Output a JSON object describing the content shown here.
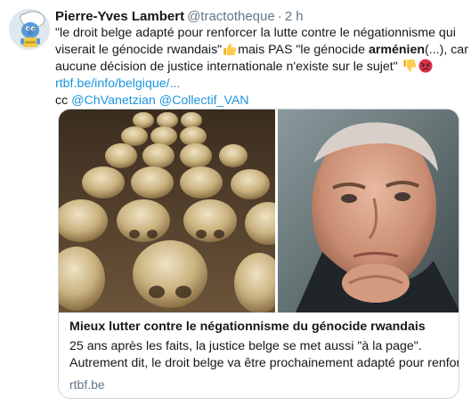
{
  "tweet": {
    "author_name": "Pierre-Yves Lambert",
    "author_handle": "@tractotheque",
    "separator": "·",
    "time": "2 h",
    "lines": {
      "l1": "\"le droit belge adapté pour renforcer la lutte contre le négationnisme qui",
      "l2a": "viserait le génocide rwandais\"",
      "l2b": "mais PAS \"le génocide ",
      "l2c": "arménien",
      "l2d": "(...), car",
      "l3": "aucune décision de justice internationale n'existe sur le sujet\"",
      "l4": "rtbf.be/info/belgique/...",
      "l5_prefix": "cc ",
      "l5_mention1": "@ChVanetzian",
      "l5_mention2": "@Collectif_VAN"
    },
    "emojis": [
      "thumbs-up",
      "thumbs-down",
      "angry-face"
    ]
  },
  "card": {
    "title": "Mieux lutter contre le négationnisme du génocide rwandais",
    "desc_line1": "25 ans après les faits, la justice belge se met aussi \"à la page\".",
    "desc_line2": "Autrement dit, le droit belge va être prochainement adapté pour renforcer",
    "domain": "rtbf.be"
  },
  "colors": {
    "text": "#14171a",
    "secondary": "#657786",
    "link": "#1b95e0",
    "border": "#ccd6dd"
  }
}
